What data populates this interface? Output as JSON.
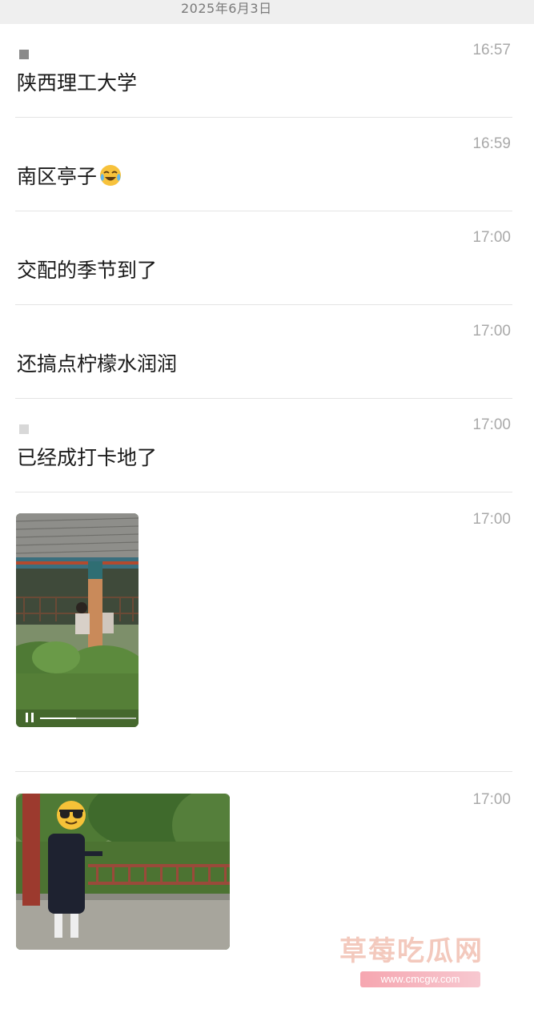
{
  "header": {
    "date": "2025年6月3日"
  },
  "messages": [
    {
      "time": "16:57",
      "text": "陕西理工大学"
    },
    {
      "time": "16:59",
      "text": "南区亭子",
      "emoji": "crying-laughing-face-icon"
    },
    {
      "time": "17:00",
      "text": "交配的季节到了"
    },
    {
      "time": "17:00",
      "text": "还搞点柠檬水润润"
    },
    {
      "time": "17:00",
      "text": "已经成打卡地了"
    }
  ],
  "media": [
    {
      "time": "17:00",
      "kind": "video",
      "icon": "pause-icon"
    },
    {
      "time": "17:00",
      "kind": "photo",
      "icon": "sunglasses-emoji-icon"
    }
  ],
  "watermark": {
    "title": "草莓吃瓜网",
    "url": "www.cmcgw.com"
  },
  "colors": {
    "text": "#1a1a1a",
    "time": "#a9a9a9",
    "divider": "#e4e4e4",
    "header_bg": "#efefef",
    "watermark": "#f3c9bd"
  }
}
